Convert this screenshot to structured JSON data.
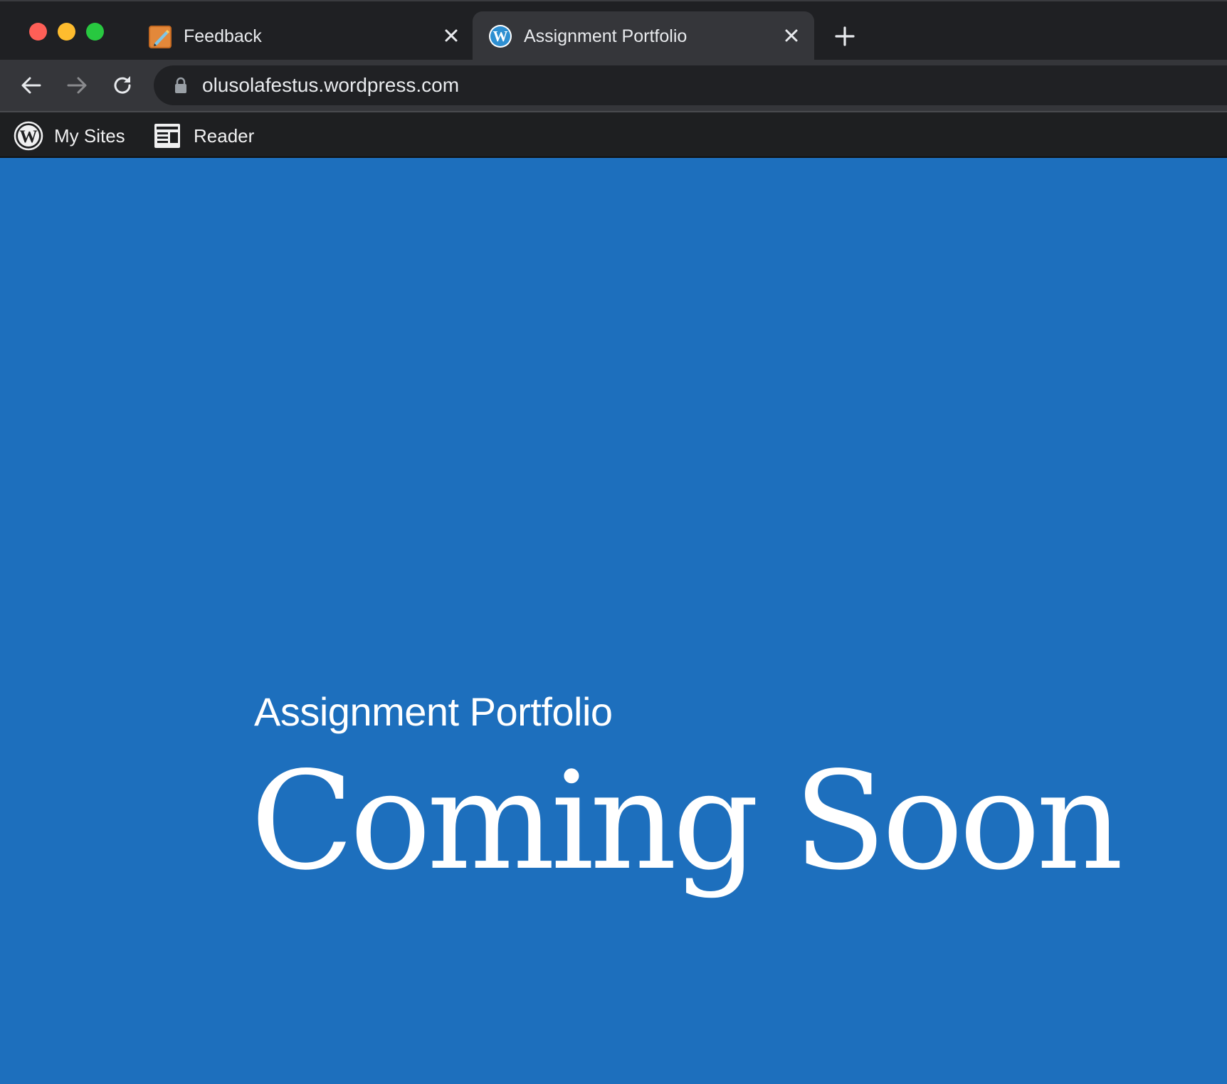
{
  "window": {
    "traffic_lights": [
      "close",
      "minimize",
      "zoom"
    ]
  },
  "tabs": [
    {
      "title": "Feedback",
      "favicon": "pencil-notebook-icon",
      "active": false
    },
    {
      "title": "Assignment Portfolio",
      "favicon": "wordpress-icon",
      "active": true
    }
  ],
  "toolbar": {
    "url": "olusolafestus.wordpress.com"
  },
  "adminbar": {
    "my_sites_label": "My Sites",
    "reader_label": "Reader"
  },
  "page": {
    "site_title": "Assignment Portfolio",
    "headline": "Coming Soon",
    "background_color": "#1d6fbd"
  },
  "colors": {
    "tabstrip": "#1f2023",
    "active_tab": "#35363a",
    "adminbar": "#1e1f21",
    "wp_blue": "#2e8fd1"
  }
}
